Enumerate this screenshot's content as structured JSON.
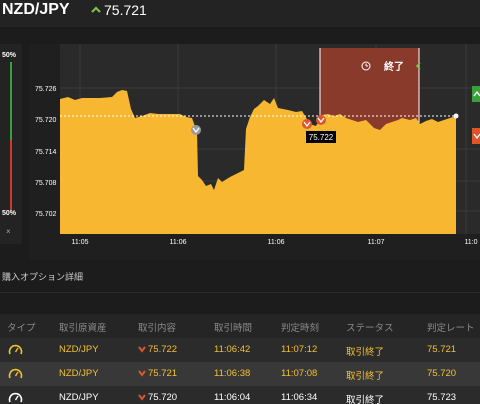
{
  "header": {
    "pair": "NZD/JPY",
    "price": "75.721"
  },
  "sentiment": {
    "up_pct": "50%",
    "down_pct": "50%",
    "close": "×"
  },
  "chart": {
    "y_ticks": [
      "75.726",
      "75.720",
      "75.714",
      "75.708",
      "75.702"
    ],
    "x_ticks": [
      "11:05",
      "11:06",
      "11:06",
      "11:07",
      "11:0"
    ],
    "end_label": "終了",
    "current_marker": "75.722",
    "colors": {
      "area": "#f7b731",
      "end_zone": "#8a3a2a",
      "up": "#3aa13a",
      "down": "#e0542b"
    }
  },
  "section_title": "購入オプション詳細",
  "table": {
    "headers": [
      "タイプ",
      "取引原資産",
      "取引内容",
      "取引時間",
      "判定時刻",
      "ステータス",
      "判定レート"
    ],
    "rows": [
      {
        "asset": "NZD/JPY",
        "content": "75.722",
        "time": "11:06:42",
        "judge": "11:07:12",
        "status": "取引終了",
        "rate": "75.721"
      },
      {
        "asset": "NZD/JPY",
        "content": "75.721",
        "time": "11:06:38",
        "judge": "11:07:08",
        "status": "取引終了",
        "rate": "75.720"
      },
      {
        "asset": "NZD/JPY",
        "content": "75.720",
        "time": "11:06:04",
        "judge": "11:06:34",
        "status": "取引終了",
        "rate": "75.723"
      }
    ]
  }
}
